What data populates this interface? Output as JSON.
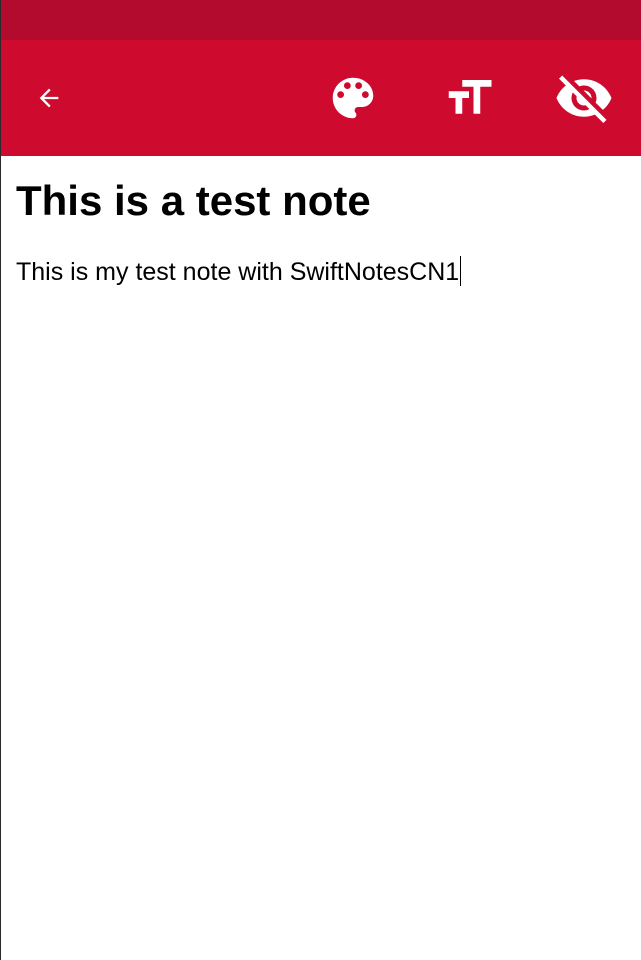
{
  "theme": {
    "status_bar_color": "#b20b2e",
    "toolbar_color": "#cf0a2f",
    "icon_color": "#ffffff"
  },
  "toolbar": {
    "icons": [
      "arrow-back-icon",
      "palette-icon",
      "text-size-icon",
      "visibility-off-icon"
    ]
  },
  "note": {
    "title": "This is a test note",
    "body": "This is my test note with SwiftNotesCN1"
  }
}
